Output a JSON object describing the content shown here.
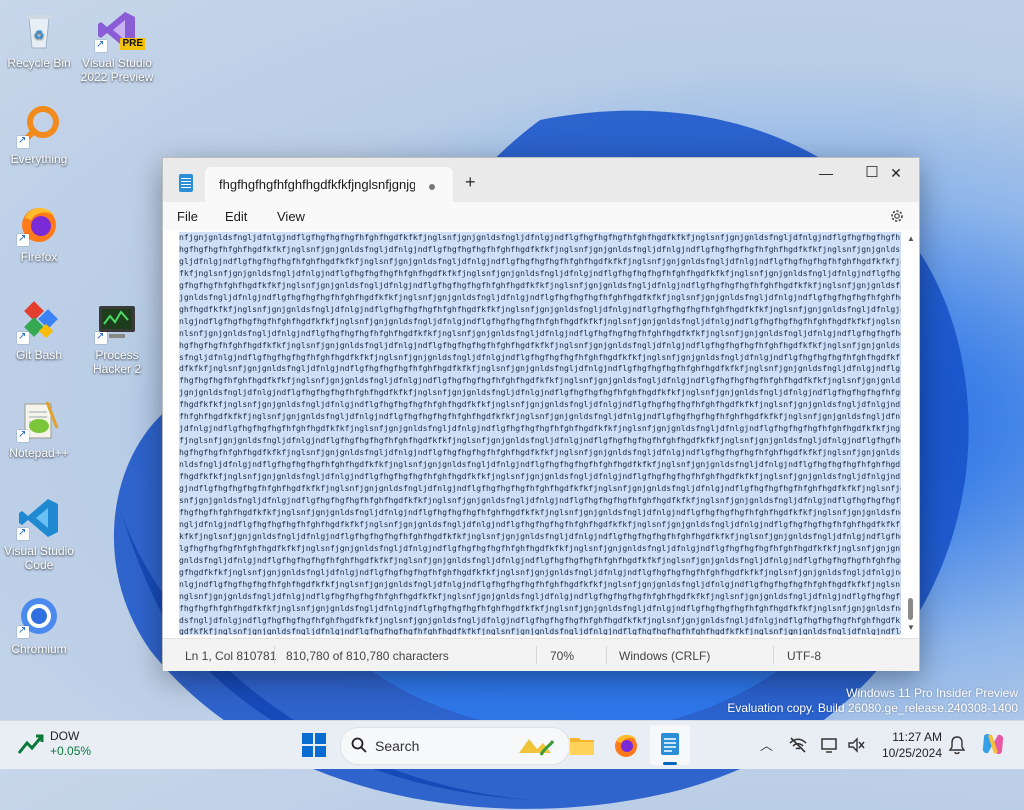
{
  "desktop": {
    "icons": [
      {
        "label": "Recycle Bin"
      },
      {
        "label": "Visual Studio 2022 Preview",
        "badge": "PRE"
      },
      {
        "label": "Everything"
      },
      {
        "label": "Firefox"
      },
      {
        "label": "Git Bash"
      },
      {
        "label": "Process Hacker 2"
      },
      {
        "label": "Notepad++"
      },
      {
        "label": "Visual Studio Code"
      },
      {
        "label": "Chromium"
      }
    ]
  },
  "window": {
    "tab_title": "fhgfhgfhgfhfghfhgdfkfkfjnglsnfjgnjgnlds",
    "new_tab": "+",
    "controls": {
      "minimize": "—",
      "maximize": "☐",
      "close": "✕"
    },
    "menu": [
      "File",
      "Edit",
      "View"
    ],
    "content_lines": [
      "nfjgnjgnldsfngljdfnlgjndflgfhgfhgfhgfhfghfhgdfkfkfjnglsnfjgnjgnldsfngljdfnlgjndflgfhgfhgfhgfhfghfhgdfkfkfjnglsnfjgnjgnldsfngljdfnlgjndflgfhgfhgfhgfhfgh",
      "hgfhgfhgfhfghfhgdfkfkfjnglsnfjgnjgnldsfngljdfnlgjndflgfhgfhgfhgfhfghfhgdfkfkfjnglsnfjgnjgnldsfngljdfnlgjndflgfhgfhgfhgfhfghfhgdfkfkfjnglsnfjgnjgnldsfn",
      "gljdfnlgjndflgfhgfhgfhgfhfghfhgdfkfkfjnglsnfjgnjgnldsfngljdfnlgjndflgfhgfhgfhgfhfghfhgdfkfkfjnglsnfjgnjgnldsfngljdfnlgjndflgfhgfhgfhgfhfghfhgdfkfkfjngl",
      "fkfjnglsnfjgnjgnldsfngljdfnlgjndflgfhgfhgfhgfhfghfhgdfkfkfjnglsnfjgnjgnldsfngljdfnlgjndflgfhgfhgfhgfhfghfhgdfkfkfjnglsnfjgnjgnldsfngljdfnlgjndflgfhgfhg",
      "gfhgfhgfhfghfhgdfkfkfjnglsnfjgnjgnldsfngljdfnlgjndflgfhgfhgfhgfhfghfhgdfkfkfjnglsnfjgnjgnldsfngljdfnlgjndflgfhgfhgfhgfhfghfhgdfkfkfjnglsnfjgnjgnldsfng",
      "jgnldsfngljdfnlgjndflgfhgfhgfhgfhfghfhgdfkfkfjnglsnfjgnjgnldsfngljdfnlgjndflgfhgfhgfhgfhfghfhgdfkfkfjnglsnfjgnjgnldsfngljdfnlgjndflgfhgfhgfhgfhfghfhg",
      "ghfhgdfkfkfjnglsnfjgnjgnldsfngljdfnlgjndflgfhgfhgfhgfhfghfhgdfkfkfjnglsnfjgnjgnldsfngljdfnlgjndflgfhgfhgfhgfhfghfhgdfkfkfjnglsnfjgnjgnldsfngljdfnlgjnd",
      "nlgjndflgfhgfhgfhgfhfghfhgdfkfkfjnglsnfjgnjgnldsfngljdfnlgjndflgfhgfhgfhgfhfghfhgdfkfkfjnglsnfjgnjgnldsfngljdfnlgjndflgfhgfhgfhgfhfghfhgdfkfkfjnglsnfj",
      "nlsnfjgnjgnldsfngljdfnlgjndflgfhgfhgfhgfhfghfhgdfkfkfjnglsnfjgnjgnldsfngljdfnlgjndflgfhgfhgfhgfhfghfhgdfkfkfjnglsnfjgnjgnldsfngljdfnlgjndflgfhgfhgfhgfh",
      "hgfhgfhgfhfghfhgdfkfkfjnglsnfjgnjgnldsfngljdfnlgjndflgfhgfhgfhgfhfghfhgdfkfkfjnglsnfjgnjgnldsfngljdfnlgjndflgfhgfhgfhgfhfghfhgdfkfkfjnglsnfjgnjgnldsf",
      "sfngljdfnlgjndflgfhgfhgfhgfhfghfhgdfkfkfjnglsnfjgnjgnldsfngljdfnlgjndflgfhgfhgfhgfhfghfhgdfkfkfjnglsnfjgnjgnldsfngljdfnlgjndflgfhgfhgfhgfhfghfhgdfkfk",
      "dfkfkfjnglsnfjgnjgnldsfngljdfnlgjndflgfhgfhgfhgfhfghfhgdfkfkfjnglsnfjgnjgnldsfngljdfnlgjndflgfhgfhgfhgfhfghfhgdfkfkfjnglsnfjgnjgnldsfngljdfnlgjndflgfhg",
      "fhgfhgfhgfhfghfhgdfkfkfjnglsnfjgnjgnldsfngljdfnlgjndflgfhgfhgfhgfhfghfhgdfkfkfjnglsnfjgnjgnldsfngljdfnlgjndflgfhgfhgfhgfhfghfhgdfkfkfjnglsnfjgnjgnldsf",
      "jgnjgnldsfngljdfnlgjndflgfhgfhgfhgfhfghfhgdfkfkfjnglsnfjgnjgnldsfngljdfnlgjndflgfhgfhgfhgfhfghfhgdfkfkfjnglsnfjgnjgnldsfngljdfnlgjndflgfhgfhgfhgfhfghf",
      "fhgdfkfkfjnglsnfjgnjgnldsfngljdfnlgjndflgfhgfhgfhgfhfghfhgdfkfkfjnglsnfjgnjgnldsfngljdfnlgjndflgfhgfhgfhgfhfghfhgdfkfkfjnglsnfjgnjgnldsfngljdfnlgjndfl",
      "fhfghfhgdfkfkfjnglsnfjgnjgnldsfngljdfnlgjndflgfhgfhgfhgfhfghfhgdfkfkfjnglsnfjgnjgnldsfngljdfnlgjndflgfhgfhgfhgfhfghfhgdfkfkfjnglsnfjgnjgnldsfngljdfnlg",
      "jdfnlgjndflgfhgfhgfhgfhfghfhgdfkfkfjnglsnfjgnjgnldsfngljdfnlgjndflgfhgfhgfhgfhfghfhgdfkfkfjnglsnfjgnjgnldsfngljdfnlgjndflgfhgfhgfhgfhfghfhgdfkfkfjngl",
      "fjnglsnfjgnjgnldsfngljdfnlgjndflgfhgfhgfhgfhfghfhgdfkfkfjnglsnfjgnjgnldsfngljdfnlgjndflgfhgfhgfhgfhfghfhgdfkfkfjnglsnfjgnjgnldsfngljdfnlgjndflgfhgfhgf",
      "hgfhgfhgfhfghfhgdfkfkfjnglsnfjgnjgnldsfngljdfnlgjndflgfhgfhgfhgfhfghfhgdfkfkfjnglsnfjgnjgnldsfngljdfnlgjndflgfhgfhgfhgfhfghfhgdfkfkfjnglsnfjgnjgnldsfn",
      "nldsfngljdfnlgjndflgfhgfhgfhgfhfghfhgdfkfkfjnglsnfjgnjgnldsfngljdfnlgjndflgfhgfhgfhgfhfghfhgdfkfkfjnglsnfjgnjgnldsfngljdfnlgjndflgfhgfhgfhgfhfghfhgdfk",
      "fhgdfkfkfjnglsnfjgnjgnldsfngljdfnlgjndflgfhgfhgfhgfhfghfhgdfkfkfjnglsnfjgnjgnldsfngljdfnlgjndflgfhgfhgfhgfhfghfhgdfkfkfjnglsnfjgnjgnldsfngljdfnlgjndfl",
      "gjndflgfhgfhgfhgfhfghfhgdfkfkfjnglsnfjgnjgnldsfngljdfnlgjndflgfhgfhgfhgfhfghfhgdfkfkfjnglsnfjgnjgnldsfngljdfnlgjndflgfhgfhgfhgfhfghfhgdfkfkfjnglsnfjgn",
      "snfjgnjgnldsfngljdfnlgjndflgfhgfhgfhgfhfghfhgdfkfkfjnglsnfjgnjgnldsfngljdfnlgjndflgfhgfhgfhgfhfghfhgdfkfkfjnglsnfjgnjgnldsfngljdfnlgjndflgfhgfhgfhgfhfg",
      "fhgfhgfhfghfhgdfkfkfjnglsnfjgnjgnldsfngljdfnlgjndflgfhgfhgfhgfhfghfhgdfkfkfjnglsnfjgnjgnldsfngljdfnlgjndflgfhgfhgfhgfhfghfhgdfkfkfjnglsnfjgnjgnldsfngl",
      "ngljdfnlgjndflgfhgfhgfhgfhfghfhgdfkfkfjnglsnfjgnjgnldsfngljdfnlgjndflgfhgfhgfhgfhfghfhgdfkfkfjnglsnfjgnjgnldsfngljdfnlgjndflgfhgfhgfhgfhfghfhgdfkfkfj",
      "kfkfjnglsnfjgnjgnldsfngljdfnlgjndflgfhgfhgfhgfhfghfhgdfkfkfjnglsnfjgnjgnldsfngljdfnlgjndflgfhgfhgfhgfhfghfhgdfkfkfjnglsnfjgnjgnldsfngljdfnlgjndflgfhgf",
      "lgfhgfhgfhgfhfghfhgdfkfkfjnglsnfjgnjgnldsfngljdfnlgjndflgfhgfhgfhgfhfghfhgdfkfkfjnglsnfjgnjgnldsfngljdfnlgjndflgfhgfhgfhgfhfghfhgdfkfkfjnglsnfjgnjgnl",
      "gnldsfngljdfnlgjndflgfhgfhgfhgfhfghfhgdfkfkfjnglsnfjgnjgnldsfngljdfnlgjndflgfhgfhgfhgfhfghfhgdfkfkfjnglsnfjgnjgnldsfngljdfnlgjndflgfhgfhgfhgfhfghfhgd",
      "gfhgdfkfkfjnglsnfjgnjgnldsfngljdfnlgjndflgfhgfhgfhgfhfghfhgdfkfkfjnglsnfjgnjgnldsfngljdfnlgjndflgfhgfhgfhgfhfghfhgdfkfkfjnglsnfjgnjgnldsfngljdfnlgjndf",
      "nlgjndflgfhgfhgfhgfhfghfhgdfkfkfjnglsnfjgnjgnldsfngljdfnlgjndflgfhgfhgfhgfhfghfhgdfkfkfjnglsnfjgnjgnldsfngljdfnlgjndflgfhgfhgfhgfhfghfhgdfkfkfjnglsnfj",
      "nglsnfjgnjgnldsfngljdfnlgjndflgfhgfhgfhgfhfghfhgdfkfkfjnglsnfjgnjgnldsfngljdfnlgjndflgfhgfhgfhgfhfghfhgdfkfkfjnglsnfjgnjgnldsfngljdfnlgjndflgfhgfhgfhg",
      "fhgfhgfhfghfhgdfkfkfjnglsnfjgnjgnldsfngljdfnlgjndflgfhgfhgfhgfhfghfhgdfkfkfjnglsnfjgnjgnldsfngljdfnlgjndflgfhgfhgfhgfhfghfhgdfkfkfjnglsnfjgnjgnldsfngl",
      "dsfngljdfnlgjndflgfhgfhgfhgfhfghfhgdfkfkfjnglsnfjgnjgnldsfngljdfnlgjndflgfhgfhgfhgfhfghfhgdfkfkfjnglsnfjgnjgnldsfngljdfnlgjndflgfhgfhgfhgfhfghfhgdfkf",
      "gdfkfkfjnglsnfjgnjgnldsfngljdfnlgjndflgfhgfhgfhgfhfghfhgdfkfkfjnglsnfjgnjgnldsfngljdfnlgjndflgfhgfhgfhgfhfghfhgdfkfkfjnglsnfjgnjgnldsfngljdfnlgjndflgf"
    ],
    "last_line": "ndflgfhgfhgfhgfhfghfhgdfkfkfjnglsnfjgnjgnldsfngljdfnlgjndflg",
    "status": {
      "position": "Ln 1, Col 810781",
      "characters": "810,780 of 810,780 characters",
      "zoom": "70%",
      "line_ending": "Windows (CRLF)",
      "encoding": "UTF-8"
    }
  },
  "watermark": {
    "line1": "Windows 11 Pro Insider Preview",
    "line2": "Evaluation copy. Build 26080.ge_release.240308-1400"
  },
  "taskbar": {
    "widget_name": "DOW",
    "widget_change": "+0.05%",
    "search_placeholder": "Search",
    "time": "11:27 AM",
    "date": "10/25/2024",
    "colors": {
      "accent": "#0067c0",
      "widget_change": "#0a7a3b"
    }
  }
}
